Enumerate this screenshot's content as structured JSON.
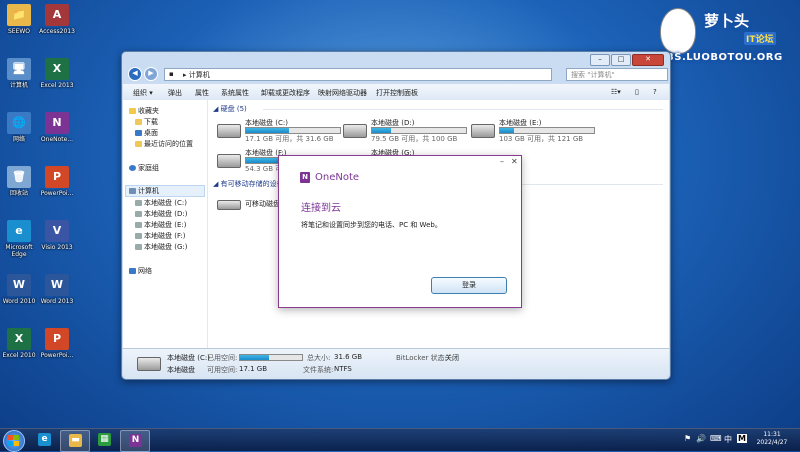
{
  "desktop": {
    "icons": [
      {
        "label": "SEEWO",
        "glyph": "📁",
        "color": "#e8b94a"
      },
      {
        "label": "Access2013",
        "glyph": "A",
        "color": "#a4373a"
      },
      {
        "label": "计算机",
        "glyph": "🖥",
        "color": "#5a8ec8"
      },
      {
        "label": "Excel 2013",
        "glyph": "X",
        "color": "#1e7145"
      },
      {
        "label": "网络",
        "glyph": "🌐",
        "color": "#3a7ac4"
      },
      {
        "label": "OneNote...",
        "glyph": "N",
        "color": "#7b3494"
      },
      {
        "label": "回收站",
        "glyph": "🗑",
        "color": "#7ea7d4"
      },
      {
        "label": "PowerPoi...",
        "glyph": "P",
        "color": "#d24726"
      },
      {
        "label": "Microsoft Edge",
        "glyph": "e",
        "color": "#1a8fd0"
      },
      {
        "label": "Visio 2013",
        "glyph": "V",
        "color": "#3955a3"
      },
      {
        "label": "Word 2010",
        "glyph": "W",
        "color": "#2b579a"
      },
      {
        "label": "Word 2013",
        "glyph": "W",
        "color": "#2b579a"
      },
      {
        "label": "Excel 2010",
        "glyph": "X",
        "color": "#1e7145"
      },
      {
        "label": "PowerPoi...",
        "glyph": "P",
        "color": "#d24726"
      }
    ]
  },
  "watermark": {
    "line1": "萝卜头",
    "line2": "IT论坛",
    "line3": "BBS.LUOBOTOU.ORG"
  },
  "explorer": {
    "address": "▸ 计算机",
    "search_placeholder": "搜索 \"计算机\"",
    "window_controls": {
      "minimize": "–",
      "maximize": "□",
      "close": "✕"
    },
    "toolbar": [
      "组织 ▾",
      "弹出",
      "属性",
      "系统属性",
      "卸载或更改程序",
      "映射网络驱动器",
      "打开控制面板"
    ],
    "sidebar": {
      "favorites": "收藏夹",
      "fav_items": [
        "下载",
        "桌面",
        "最近访问的位置"
      ],
      "homegroup": "家庭组",
      "computer": "计算机",
      "computer_items": [
        "本地磁盘 (C:)",
        "本地磁盘 (D:)",
        "本地磁盘 (E:)",
        "本地磁盘 (F:)",
        "本地磁盘 (G:)"
      ],
      "network": "网络"
    },
    "groups": {
      "hdd": "硬盘 (5)",
      "removable": "有可移动存储的设备"
    },
    "drives": [
      {
        "name": "本地磁盘 (C:)",
        "free": "17.1 GB 可用，共 31.6 GB",
        "used": 0.46
      },
      {
        "name": "本地磁盘 (D:)",
        "free": "79.5 GB 可用，共 100 GB",
        "used": 0.2
      },
      {
        "name": "本地磁盘 (E:)",
        "free": "103 GB 可用，共 121 GB",
        "used": 0.15
      },
      {
        "name": "本地磁盘 (F:)",
        "free": "54.3 GB 可用，",
        "used": 0.5
      },
      {
        "name": "本地磁盘 (G:)",
        "free": "",
        "used": 0.3
      }
    ],
    "removable_item": "可移动磁盘 (H",
    "status": {
      "drive": "本地磁盘 (C:)",
      "drive_type": "本地磁盘",
      "used_label": "已用空间:",
      "free_label": "可用空间:",
      "free_value": "17.1 GB",
      "total_label": "总大小:",
      "total_value": "31.6 GB",
      "fs_label": "文件系统:",
      "fs_value": "NTFS",
      "bitlocker_label": "BitLocker 状态:",
      "bitlocker_value": "关闭",
      "used_fraction": 0.46
    }
  },
  "dialog": {
    "app": "OneNote",
    "heading": "连接到云",
    "text": "将笔记和设置同步到您的电话、PC 和 Web。",
    "button": "登录",
    "minimize": "–",
    "close": "✕"
  },
  "taskbar": {
    "tray": [
      "⚑",
      "🔊",
      "⌨",
      "中",
      "M"
    ],
    "time": "11:31",
    "date": "2022/4/27"
  }
}
